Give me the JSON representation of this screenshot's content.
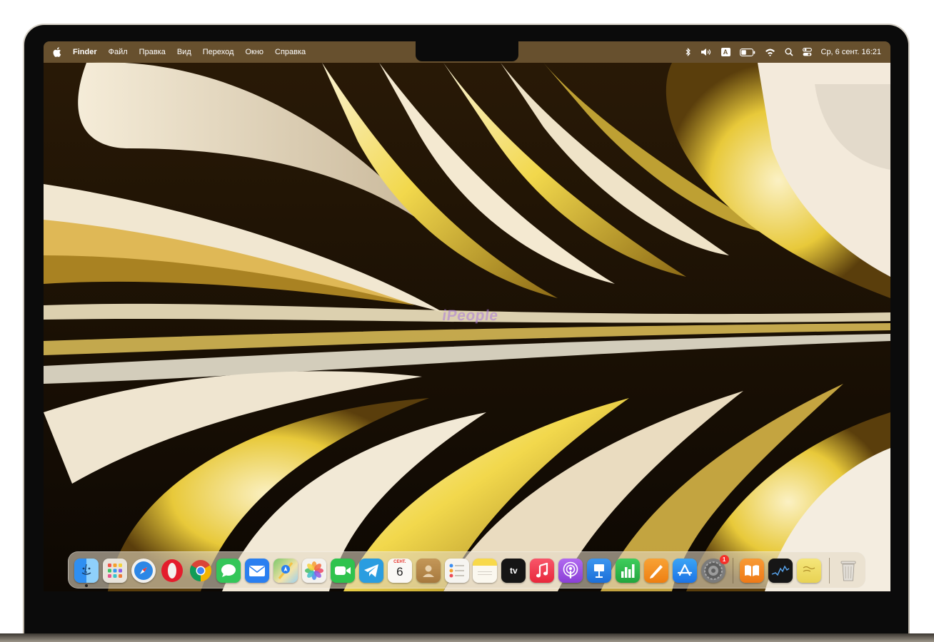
{
  "menubar": {
    "app_name": "Finder",
    "items": [
      "Файл",
      "Правка",
      "Вид",
      "Переход",
      "Окно",
      "Справка"
    ],
    "status_icons": [
      "bluetooth-icon",
      "volume-icon",
      "input-source-icon",
      "battery-icon",
      "wifi-icon",
      "spotlight-icon",
      "control-center-icon"
    ],
    "input_source": "A",
    "clock": "Ср, 6 сент.  16:21"
  },
  "watermark": "iPeople",
  "dock": {
    "apps": [
      {
        "name": "Finder",
        "icon": "finder-icon",
        "color": "#2f8ff2",
        "running": true
      },
      {
        "name": "Launchpad",
        "icon": "launchpad-icon",
        "color": "#e9e4dc"
      },
      {
        "name": "Safari",
        "icon": "safari-icon",
        "color": "#2d87e6"
      },
      {
        "name": "Opera",
        "icon": "opera-icon",
        "color": "#f3f1ee"
      },
      {
        "name": "Chrome",
        "icon": "chrome-icon",
        "color": "#f3f1ee"
      },
      {
        "name": "Messages",
        "icon": "messages-icon",
        "color": "#34c659"
      },
      {
        "name": "Mail",
        "icon": "mail-icon",
        "color": "#2a7ff0"
      },
      {
        "name": "Maps",
        "icon": "maps-icon",
        "color": "#7cc86b"
      },
      {
        "name": "Photos",
        "icon": "photos-icon",
        "color": "#f4f2ee"
      },
      {
        "name": "FaceTime",
        "icon": "facetime-icon",
        "color": "#2fc34e"
      },
      {
        "name": "Telegram",
        "icon": "telegram-icon",
        "color": "#2a9de0"
      },
      {
        "name": "Calendar",
        "icon": "calendar-icon",
        "color": "#faf8f5",
        "month": "СЕНТ.",
        "day": "6"
      },
      {
        "name": "Contacts",
        "icon": "contacts-icon",
        "color": "#b88a4d"
      },
      {
        "name": "Reminders",
        "icon": "reminders-icon",
        "color": "#f6f4f0"
      },
      {
        "name": "Notes",
        "icon": "notes-icon",
        "color": "#f8d94a"
      },
      {
        "name": "TV",
        "icon": "apple-tv-icon",
        "color": "#151515",
        "label": "tv"
      },
      {
        "name": "Music",
        "icon": "music-icon",
        "color": "#f33a4e"
      },
      {
        "name": "Podcasts",
        "icon": "podcasts-icon",
        "color": "#9a4fe0"
      },
      {
        "name": "Keynote",
        "icon": "keynote-icon",
        "color": "#2a86e8"
      },
      {
        "name": "Numbers",
        "icon": "numbers-icon",
        "color": "#2dbb4a"
      },
      {
        "name": "Pages",
        "icon": "pages-icon",
        "color": "#f39220"
      },
      {
        "name": "App Store",
        "icon": "app-store-icon",
        "color": "#2c8cf2"
      },
      {
        "name": "System Settings",
        "icon": "settings-icon",
        "color": "#7b7b7b",
        "badge": "1"
      }
    ],
    "recent_apps": [
      {
        "name": "Books",
        "icon": "books-icon",
        "color": "#f38a25"
      },
      {
        "name": "Stocks",
        "icon": "stocks-icon",
        "color": "#161616"
      },
      {
        "name": "Stickies",
        "icon": "stickies-icon",
        "color": "#f2e06a"
      }
    ],
    "trash": {
      "name": "Trash",
      "icon": "trash-icon",
      "color": "#d9d4cc"
    }
  }
}
